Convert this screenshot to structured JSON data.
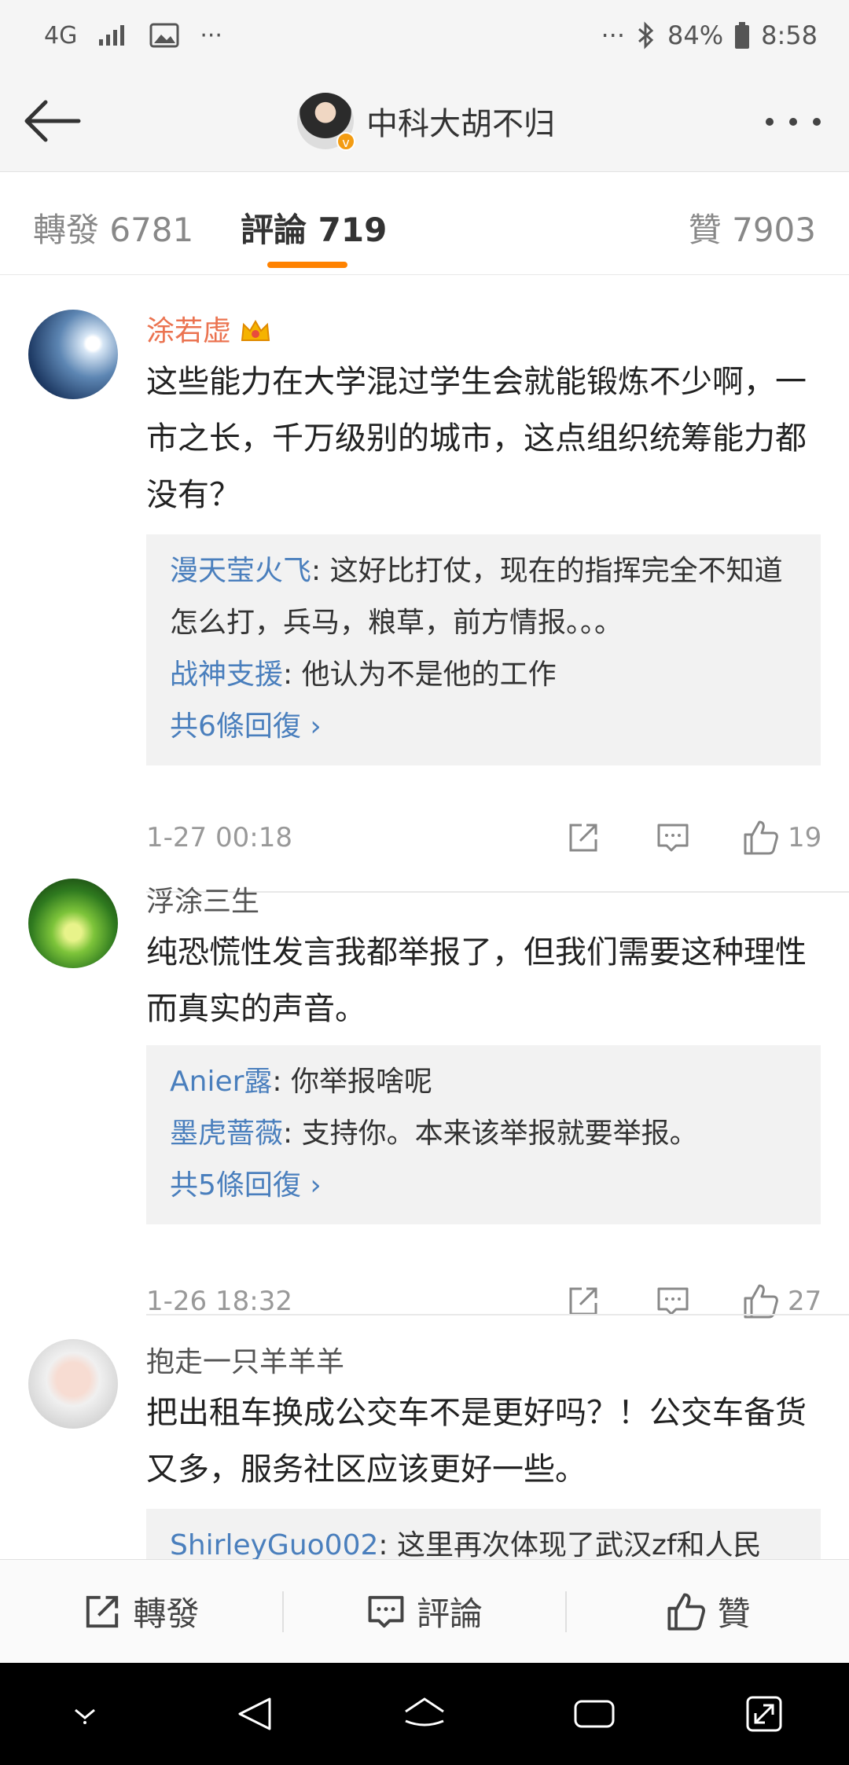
{
  "status_bar": {
    "network": "4G",
    "overflow_left": "···",
    "overflow_right": "···",
    "battery": "84%",
    "time": "8:58"
  },
  "header": {
    "title": "中科大胡不归",
    "verified_badge": "v"
  },
  "tabs": [
    {
      "label": "轉發 6781"
    },
    {
      "label": "評論 719"
    },
    {
      "label": "贊 7903"
    }
  ],
  "comments": [
    {
      "user": "涂若虚",
      "text": "这些能力在大学混过学生会就能锻炼不少啊，一市之长，千万级别的城市，这点组织统筹能力都没有？",
      "replies": [
        {
          "user": "漫天莹火飞",
          "text": ": 这好比打仗，现在的指挥完全不知道怎么打，兵马，粮草，前方情报。。。"
        },
        {
          "user": "战神支援",
          "text": ": 他认为不是他的工作"
        }
      ],
      "total_replies": "共6條回復 ›",
      "date": "1-27 00:18",
      "likes": "19"
    },
    {
      "user": "浮涂三生",
      "text": "纯恐慌性发言我都举报了，但我们需要这种理性而真实的声音。",
      "replies": [
        {
          "user": "Anier露",
          "text": ": 你举报啥呢"
        },
        {
          "user": "墨虎蔷薇",
          "text": ": 支持你。本来该举报就要举报。"
        }
      ],
      "total_replies": "共5條回復 ›",
      "date": "1-26 18:32",
      "likes": "27"
    },
    {
      "user": "抱走一只羊羊羊",
      "text": "把出租车换成公交车不是更好吗？！公交车备货又多，服务社区应该更好一些。",
      "replies": [
        {
          "user": "ShirleyGuo002",
          "text": ": 这里再次体现了武汉zf和人民"
        }
      ]
    }
  ],
  "actions": {
    "repost": "轉發",
    "comment": "評論",
    "like": "贊"
  },
  "colors": {
    "accent": "#ff8200",
    "link": "#4a7fbd",
    "vip_name": "#eb7350"
  }
}
